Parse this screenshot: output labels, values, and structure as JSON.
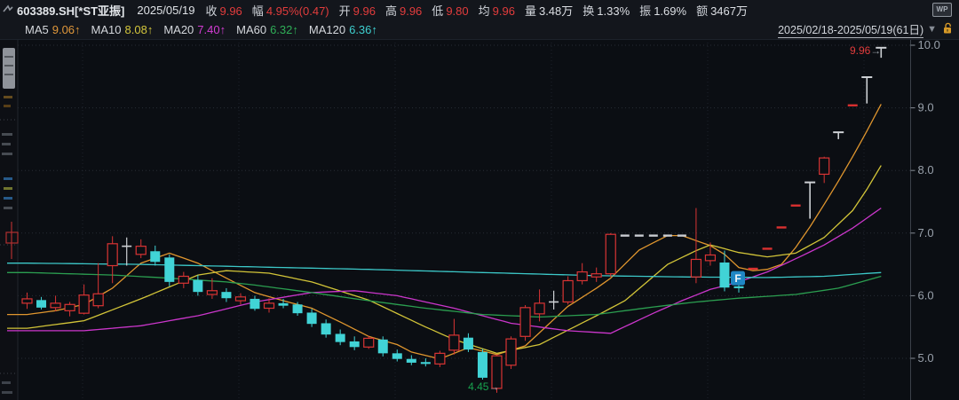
{
  "header": {
    "code": "603389.SH[*ST亚振]",
    "date": "2025/05/19",
    "fields": [
      {
        "label": "收",
        "value": "9.96",
        "tone": "red"
      },
      {
        "label": "幅",
        "value": "4.95%(0.47)",
        "tone": "red"
      },
      {
        "label": "开",
        "value": "9.96",
        "tone": "red"
      },
      {
        "label": "高",
        "value": "9.96",
        "tone": "red"
      },
      {
        "label": "低",
        "value": "9.80",
        "tone": "red"
      },
      {
        "label": "均",
        "value": "9.96",
        "tone": "red"
      },
      {
        "label": "量",
        "value": "3.48万",
        "tone": "white"
      },
      {
        "label": "换",
        "value": "1.33%",
        "tone": "white"
      },
      {
        "label": "振",
        "value": "1.69%",
        "tone": "white"
      },
      {
        "label": "额",
        "value": "3467万",
        "tone": "white"
      }
    ],
    "wp_badge": "WP"
  },
  "ma_bar": {
    "items": [
      {
        "label": "MA5",
        "value": "9.06",
        "arrow": "↑",
        "color": "#e0973a"
      },
      {
        "label": "MA10",
        "value": "8.08",
        "arrow": "↑",
        "color": "#d3c63c"
      },
      {
        "label": "MA20",
        "value": "7.40",
        "arrow": "↑",
        "color": "#d43cd4"
      },
      {
        "label": "MA60",
        "value": "6.32",
        "arrow": "↑",
        "color": "#2fae57"
      },
      {
        "label": "MA120",
        "value": "6.36",
        "arrow": "↑",
        "color": "#3ecfcf"
      }
    ],
    "range_label": "2025/02/18-2025/05/19(61日)",
    "dropdown_icon": "▼",
    "lock_icon": "unlocked-padlock"
  },
  "chart_data": {
    "type": "candlestick",
    "title": "603389.SH *ST亚振 日K",
    "date_range": "2025/02/18-2025/05/19",
    "days": 61,
    "ylim": [
      4.3,
      10.1
    ],
    "yticks": [
      10.0,
      9.0,
      8.0,
      7.0,
      6.0,
      5.0
    ],
    "grid": true,
    "colors": {
      "up": "#d93434",
      "down": "#41d3d6",
      "neutral": "#cdd0d4",
      "flat_dash": "#c9ccd1",
      "limit_dash": "#d93030"
    },
    "candles_note": "each = [date, open, high, low, close, style]; style u=up(red hollow) d=down(cyan) j=doji(white cross) f=suspension flat dash(white) l=one-word limit dash(red) t=T-bar(white)",
    "candles": [
      [
        "02/18",
        5.88,
        6.05,
        5.79,
        5.95,
        "u"
      ],
      [
        "02/19",
        5.93,
        5.98,
        5.78,
        5.81,
        "d"
      ],
      [
        "02/20",
        5.81,
        6.0,
        5.75,
        5.88,
        "u"
      ],
      [
        "02/21",
        5.76,
        5.9,
        5.67,
        5.86,
        "u"
      ],
      [
        "02/24",
        5.72,
        6.18,
        5.7,
        6.01,
        "u"
      ],
      [
        "02/25",
        5.84,
        6.52,
        5.8,
        6.03,
        "u"
      ],
      [
        "02/26",
        6.48,
        6.95,
        6.2,
        6.83,
        "u"
      ],
      [
        "02/27",
        6.8,
        6.93,
        6.48,
        6.79,
        "j"
      ],
      [
        "02/28",
        6.66,
        6.9,
        6.6,
        6.79,
        "u"
      ],
      [
        "03/03",
        6.71,
        6.8,
        6.48,
        6.54,
        "d"
      ],
      [
        "03/04",
        6.61,
        6.66,
        6.15,
        6.22,
        "d"
      ],
      [
        "03/05",
        6.2,
        6.38,
        6.12,
        6.31,
        "u"
      ],
      [
        "03/06",
        6.25,
        6.33,
        6.0,
        6.06,
        "d"
      ],
      [
        "03/07",
        6.02,
        6.28,
        5.95,
        6.08,
        "u"
      ],
      [
        "03/10",
        6.06,
        6.12,
        5.9,
        5.96,
        "d"
      ],
      [
        "03/11",
        5.92,
        6.04,
        5.86,
        5.98,
        "u"
      ],
      [
        "03/12",
        5.95,
        6.0,
        5.76,
        5.79,
        "d"
      ],
      [
        "03/13",
        5.8,
        5.96,
        5.73,
        5.88,
        "u"
      ],
      [
        "03/14",
        5.88,
        5.95,
        5.8,
        5.84,
        "d"
      ],
      [
        "03/17",
        5.86,
        5.9,
        5.68,
        5.72,
        "d"
      ],
      [
        "03/18",
        5.73,
        5.79,
        5.5,
        5.55,
        "d"
      ],
      [
        "03/19",
        5.56,
        5.62,
        5.33,
        5.38,
        "d"
      ],
      [
        "03/20",
        5.39,
        5.46,
        5.21,
        5.26,
        "d"
      ],
      [
        "03/21",
        5.27,
        5.35,
        5.13,
        5.18,
        "d"
      ],
      [
        "03/24",
        5.18,
        5.36,
        5.15,
        5.32,
        "u"
      ],
      [
        "03/25",
        5.3,
        5.35,
        5.03,
        5.08,
        "d"
      ],
      [
        "03/26",
        5.08,
        5.14,
        4.95,
        4.99,
        "d"
      ],
      [
        "03/27",
        4.99,
        5.05,
        4.89,
        4.93,
        "d"
      ],
      [
        "03/28",
        4.94,
        5.0,
        4.87,
        4.91,
        "d"
      ],
      [
        "03/31",
        4.91,
        5.12,
        4.86,
        5.08,
        "u"
      ],
      [
        "04/01",
        5.13,
        5.63,
        5.06,
        5.37,
        "u"
      ],
      [
        "04/02",
        5.33,
        5.4,
        5.1,
        5.14,
        "d"
      ],
      [
        "04/03",
        5.1,
        5.15,
        4.66,
        4.69,
        "d"
      ],
      [
        "04/07",
        4.52,
        5.06,
        4.45,
        5.04,
        "u"
      ],
      [
        "04/08",
        4.89,
        5.35,
        4.83,
        5.31,
        "u"
      ],
      [
        "04/09",
        5.35,
        5.85,
        5.28,
        5.81,
        "u"
      ],
      [
        "04/10",
        5.71,
        6.1,
        5.59,
        5.88,
        "u"
      ],
      [
        "04/11",
        5.89,
        6.08,
        5.78,
        5.9,
        "j"
      ],
      [
        "04/14",
        5.9,
        6.31,
        5.86,
        6.24,
        "u"
      ],
      [
        "04/15",
        6.24,
        6.52,
        6.18,
        6.38,
        "u"
      ],
      [
        "04/16",
        6.3,
        6.45,
        6.22,
        6.35,
        "u"
      ],
      [
        "04/17",
        6.35,
        7.0,
        6.3,
        6.98,
        "u"
      ],
      [
        "04/18",
        6.96,
        6.96,
        6.96,
        6.96,
        "f"
      ],
      [
        "04/21",
        6.96,
        6.96,
        6.96,
        6.96,
        "f"
      ],
      [
        "04/22",
        6.96,
        6.96,
        6.96,
        6.96,
        "f"
      ],
      [
        "04/23",
        6.96,
        6.96,
        6.96,
        6.96,
        "f"
      ],
      [
        "04/24",
        6.96,
        6.96,
        6.96,
        6.96,
        "f"
      ],
      [
        "04/25",
        6.3,
        7.4,
        6.2,
        6.58,
        "u"
      ],
      [
        "04/28",
        6.56,
        6.85,
        6.48,
        6.65,
        "u"
      ],
      [
        "04/29",
        6.53,
        6.72,
        6.07,
        6.13,
        "d"
      ],
      [
        "04/30",
        6.15,
        6.3,
        6.05,
        6.12,
        "d"
      ],
      [
        "05/06",
        6.43,
        6.43,
        6.43,
        6.43,
        "l"
      ],
      [
        "05/07",
        6.75,
        6.75,
        6.75,
        6.75,
        "l"
      ],
      [
        "05/08",
        7.09,
        7.09,
        7.09,
        7.09,
        "l"
      ],
      [
        "05/09",
        7.44,
        7.44,
        7.44,
        7.44,
        "l"
      ],
      [
        "05/12",
        7.81,
        7.81,
        7.23,
        7.81,
        "t"
      ],
      [
        "05/13",
        7.94,
        8.22,
        7.8,
        8.2,
        "u"
      ],
      [
        "05/14",
        8.61,
        8.61,
        8.5,
        8.61,
        "t"
      ],
      [
        "05/15",
        9.04,
        9.04,
        9.04,
        9.04,
        "l"
      ],
      [
        "05/16",
        9.49,
        9.49,
        9.07,
        9.49,
        "t"
      ],
      [
        "05/19",
        9.96,
        9.96,
        9.8,
        9.96,
        "t"
      ]
    ],
    "ma_lines": [
      {
        "name": "MA5",
        "color": "#e0962e",
        "points": [
          [
            0,
            5.7
          ],
          [
            2,
            5.76
          ],
          [
            4,
            5.86
          ],
          [
            6,
            6.12
          ],
          [
            8,
            6.52
          ],
          [
            10,
            6.68
          ],
          [
            12,
            6.52
          ],
          [
            14,
            6.28
          ],
          [
            16,
            6.05
          ],
          [
            18,
            5.92
          ],
          [
            20,
            5.8
          ],
          [
            22,
            5.58
          ],
          [
            24,
            5.35
          ],
          [
            26,
            5.22
          ],
          [
            27,
            5.1
          ],
          [
            29,
            4.99
          ],
          [
            31,
            5.17
          ],
          [
            33,
            5.06
          ],
          [
            35,
            5.2
          ],
          [
            38,
            5.83
          ],
          [
            40,
            6.12
          ],
          [
            41,
            6.28
          ],
          [
            43,
            6.73
          ],
          [
            45,
            6.96
          ],
          [
            46,
            6.96
          ],
          [
            47,
            6.88
          ],
          [
            48,
            6.8
          ],
          [
            49,
            6.66
          ],
          [
            50,
            6.45
          ],
          [
            51,
            6.4
          ],
          [
            52,
            6.42
          ],
          [
            53,
            6.5
          ],
          [
            54,
            6.77
          ],
          [
            55,
            7.1
          ],
          [
            56,
            7.46
          ],
          [
            57,
            7.83
          ],
          [
            58,
            8.22
          ],
          [
            59,
            8.63
          ],
          [
            60,
            9.06
          ]
        ]
      },
      {
        "name": "MA10",
        "color": "#d2c438",
        "points": [
          [
            0,
            5.48
          ],
          [
            4,
            5.6
          ],
          [
            8,
            5.95
          ],
          [
            12,
            6.33
          ],
          [
            14,
            6.4
          ],
          [
            17,
            6.36
          ],
          [
            20,
            6.22
          ],
          [
            24,
            5.93
          ],
          [
            28,
            5.5
          ],
          [
            30,
            5.3
          ],
          [
            33,
            5.08
          ],
          [
            36,
            5.22
          ],
          [
            38,
            5.45
          ],
          [
            40,
            5.68
          ],
          [
            42,
            5.92
          ],
          [
            45,
            6.5
          ],
          [
            47,
            6.72
          ],
          [
            48,
            6.81
          ],
          [
            50,
            6.69
          ],
          [
            52,
            6.62
          ],
          [
            54,
            6.68
          ],
          [
            56,
            6.93
          ],
          [
            58,
            7.36
          ],
          [
            59,
            7.7
          ],
          [
            60,
            8.08
          ]
        ]
      },
      {
        "name": "MA20",
        "color": "#cb36cb",
        "points": [
          [
            0,
            5.44
          ],
          [
            4,
            5.44
          ],
          [
            8,
            5.52
          ],
          [
            12,
            5.68
          ],
          [
            16,
            5.9
          ],
          [
            20,
            6.05
          ],
          [
            23,
            6.08
          ],
          [
            26,
            6.0
          ],
          [
            30,
            5.8
          ],
          [
            34,
            5.56
          ],
          [
            38,
            5.44
          ],
          [
            41,
            5.4
          ],
          [
            44,
            5.72
          ],
          [
            46,
            5.92
          ],
          [
            48,
            6.1
          ],
          [
            50,
            6.22
          ],
          [
            52,
            6.38
          ],
          [
            54,
            6.59
          ],
          [
            56,
            6.81
          ],
          [
            58,
            7.08
          ],
          [
            60,
            7.4
          ]
        ]
      },
      {
        "name": "MA60",
        "color": "#2b9e50",
        "points": [
          [
            0,
            6.37
          ],
          [
            6,
            6.33
          ],
          [
            10,
            6.28
          ],
          [
            14,
            6.22
          ],
          [
            16,
            6.17
          ],
          [
            20,
            6.05
          ],
          [
            24,
            5.92
          ],
          [
            28,
            5.8
          ],
          [
            32,
            5.7
          ],
          [
            36,
            5.66
          ],
          [
            40,
            5.7
          ],
          [
            44,
            5.82
          ],
          [
            47,
            5.9
          ],
          [
            50,
            5.96
          ],
          [
            54,
            6.02
          ],
          [
            57,
            6.12
          ],
          [
            60,
            6.31
          ]
        ]
      },
      {
        "name": "MA120",
        "color": "#3cc8c8",
        "points": [
          [
            0,
            6.52
          ],
          [
            8,
            6.5
          ],
          [
            16,
            6.46
          ],
          [
            24,
            6.42
          ],
          [
            32,
            6.37
          ],
          [
            40,
            6.32
          ],
          [
            46,
            6.3
          ],
          [
            52,
            6.29
          ],
          [
            56,
            6.31
          ],
          [
            60,
            6.37
          ]
        ]
      }
    ],
    "annotations": {
      "low_label": {
        "text": "4.45",
        "arrow": "→",
        "day": 33,
        "color": "#18a24e"
      },
      "high_label": {
        "text": "9.96",
        "arrow": "→",
        "day": 60,
        "color": "#e23c3c"
      },
      "flag": {
        "text": "F",
        "day": 50,
        "price": 6.28,
        "bg": "#1f86c4"
      },
      "suspension_dash_level": 6.96
    },
    "legend_position": "top-left",
    "x_axis_labels_visible": false
  }
}
